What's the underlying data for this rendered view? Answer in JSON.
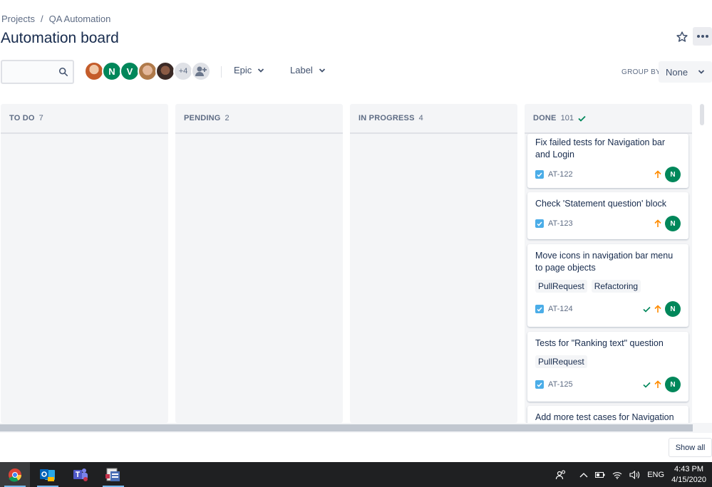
{
  "breadcrumb": {
    "root": "Projects",
    "separator": "/",
    "project": "QA Automation"
  },
  "title": "Automation board",
  "search": {
    "value": "",
    "placeholder": ""
  },
  "avatars": {
    "n_letter": "N",
    "v_letter": "V",
    "more_count": "+4"
  },
  "filters": {
    "epic": "Epic",
    "label": "Label"
  },
  "group_by": {
    "label": "GROUP BY",
    "value": "None"
  },
  "columns": [
    {
      "title": "TO DO",
      "count": "7"
    },
    {
      "title": "PENDING",
      "count": "2"
    },
    {
      "title": "IN PROGRESS",
      "count": "4"
    },
    {
      "title": "DONE",
      "count": "101"
    }
  ],
  "cards": [
    {
      "summary": "Fix failed tests for Navigation bar and Login",
      "key": "AT-122",
      "assignee": "N",
      "labels": []
    },
    {
      "summary": "Check 'Statement question' block",
      "key": "AT-123",
      "assignee": "N",
      "labels": []
    },
    {
      "summary": "Move icons in navigation bar menu to page objects",
      "key": "AT-124",
      "assignee": "N",
      "labels": [
        "PullRequest",
        "Refactoring"
      ]
    },
    {
      "summary": "Tests for \"Ranking text\" question",
      "key": "AT-125",
      "assignee": "N",
      "labels": [
        "PullRequest"
      ]
    },
    {
      "summary": "Add more test cases for Navigation",
      "key": "",
      "assignee": "",
      "labels": []
    }
  ],
  "show_all": "Show all",
  "taskbar": {
    "apps": [
      "chrome-icon",
      "outlook-icon",
      "teams-icon",
      "generic-app-icon"
    ],
    "language": "ENG",
    "time": "4:43 PM",
    "date": "4/15/2020"
  },
  "colors": {
    "accent": "#00875a",
    "priority_high": "#ff8b00",
    "done_check": "#00875a",
    "issue_type": "#4bade8"
  }
}
